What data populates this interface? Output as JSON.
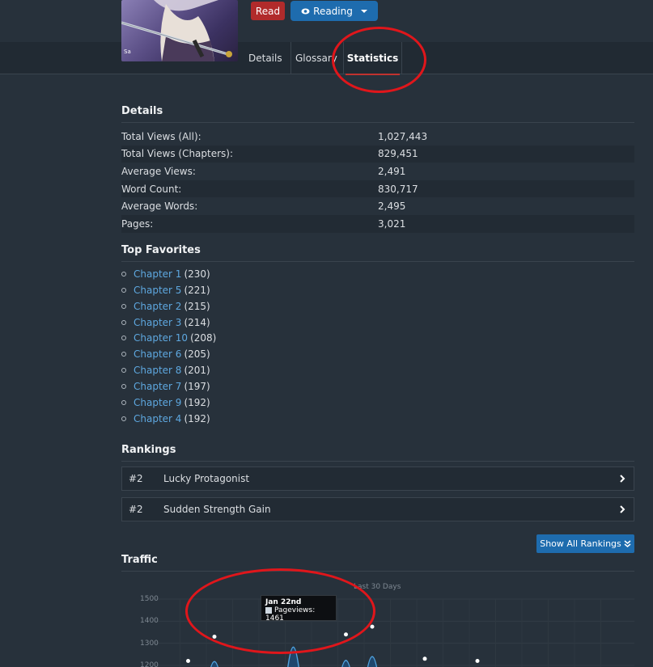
{
  "header": {
    "read_label": "Read",
    "reading_label": "Reading"
  },
  "tabs": [
    {
      "label": "Details"
    },
    {
      "label": "Glossary"
    },
    {
      "label": "Statistics"
    }
  ],
  "details": {
    "title": "Details",
    "rows": [
      {
        "label": "Total Views (All):",
        "value": "1,027,443"
      },
      {
        "label": "Total Views (Chapters):",
        "value": "829,451"
      },
      {
        "label": "Average Views:",
        "value": "2,491"
      },
      {
        "label": "Word Count:",
        "value": "830,717"
      },
      {
        "label": "Average Words:",
        "value": "2,495"
      },
      {
        "label": "Pages:",
        "value": "3,021"
      }
    ]
  },
  "favorites": {
    "title": "Top Favorites",
    "items": [
      {
        "label": "Chapter 1",
        "count": "(230)"
      },
      {
        "label": "Chapter 5",
        "count": "(221)"
      },
      {
        "label": "Chapter 2",
        "count": "(215)"
      },
      {
        "label": "Chapter 3",
        "count": "(214)"
      },
      {
        "label": "Chapter 10",
        "count": "(208)"
      },
      {
        "label": "Chapter 6",
        "count": "(205)"
      },
      {
        "label": "Chapter 8",
        "count": "(201)"
      },
      {
        "label": "Chapter 7",
        "count": "(197)"
      },
      {
        "label": "Chapter 9",
        "count": "(192)"
      },
      {
        "label": "Chapter 4",
        "count": "(192)"
      }
    ]
  },
  "rankings": {
    "title": "Rankings",
    "items": [
      {
        "rank": "#2",
        "label": "Lucky Protagonist"
      },
      {
        "rank": "#2",
        "label": "Sudden Strength Gain"
      }
    ],
    "show_all_label": "Show All Rankings"
  },
  "traffic": {
    "title": "Traffic",
    "chart_title": "Last 30 Days",
    "tooltip_date": "Jan 22nd",
    "tooltip_value": "Pageviews: 1461"
  },
  "chart_data": {
    "type": "area",
    "title": "Last 30 Days",
    "series": [
      {
        "name": "Pageviews",
        "points": [
          [
            1,
            1220
          ],
          [
            2,
            1330
          ],
          [
            5,
            1461
          ],
          [
            7,
            1340
          ],
          [
            8,
            1375
          ],
          [
            10,
            1230
          ],
          [
            12,
            1220
          ]
        ]
      }
    ],
    "yticks": [
      "1500",
      "1400",
      "1300",
      "1200"
    ],
    "ylim": [
      1200,
      1500
    ]
  },
  "colors": {
    "accent": "#1e6cae",
    "read": "#b12b2b",
    "link": "#5ea8e0",
    "annotation": "#e0161b"
  }
}
